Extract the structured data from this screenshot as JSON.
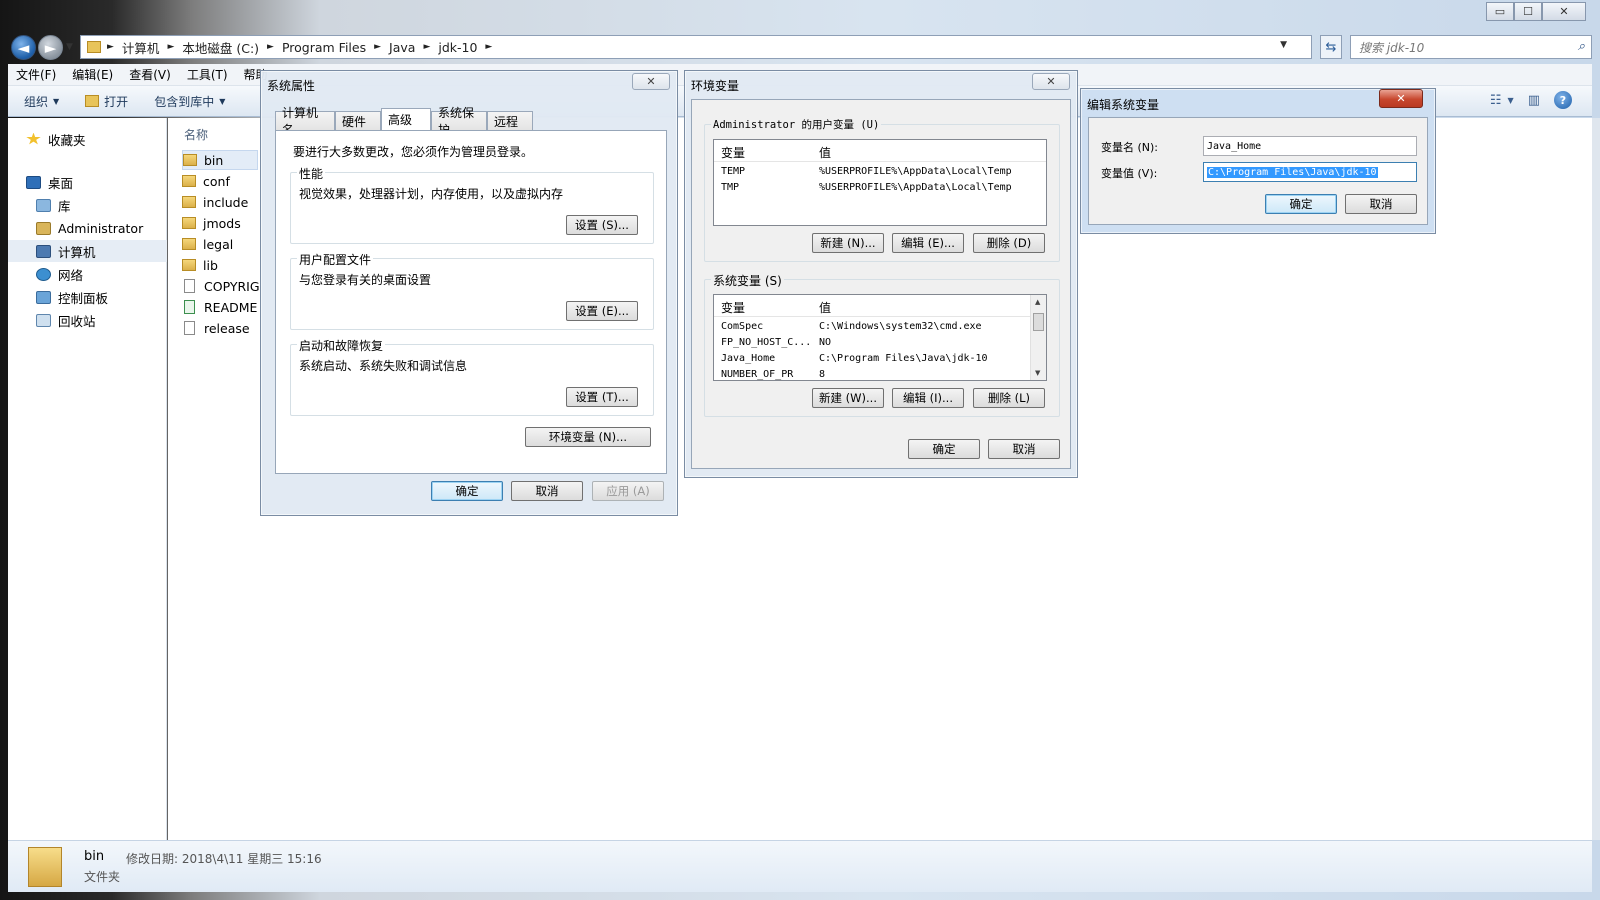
{
  "explorer": {
    "window_buttons": {
      "min": "▭",
      "max": "☐",
      "close": "✕"
    },
    "breadcrumbs": [
      "计算机",
      "本地磁盘 (C:)",
      "Program Files",
      "Java",
      "jdk-10"
    ],
    "search_placeholder": "搜索 jdk-10",
    "menu": [
      "文件(F)",
      "编辑(E)",
      "查看(V)",
      "工具(T)",
      "帮助"
    ],
    "toolbar": {
      "organize": "组织",
      "open": "打开",
      "include": "包含到库中"
    },
    "nav": {
      "favorites": "收藏夹",
      "desktop": "桌面",
      "library": "库",
      "administrator": "Administrator",
      "computer": "计算机",
      "network": "网络",
      "control_panel": "控制面板",
      "recycle_bin": "回收站"
    },
    "column_name": "名称",
    "files": [
      {
        "name": "bin",
        "type": "folder"
      },
      {
        "name": "conf",
        "type": "folder"
      },
      {
        "name": "include",
        "type": "folder"
      },
      {
        "name": "jmods",
        "type": "folder"
      },
      {
        "name": "legal",
        "type": "folder"
      },
      {
        "name": "lib",
        "type": "folder"
      },
      {
        "name": "COPYRIG",
        "type": "file"
      },
      {
        "name": "README",
        "type": "file"
      },
      {
        "name": "release",
        "type": "file"
      }
    ],
    "details": {
      "name": "bin",
      "modified": "修改日期: 2018\\4\\11 星期三 15:16",
      "type": "文件夹"
    }
  },
  "sysprops": {
    "title": "系统属性",
    "tabs": [
      "计算机名",
      "硬件",
      "高级",
      "系统保护",
      "远程"
    ],
    "admin_note": "要进行大多数更改，您必须作为管理员登录。",
    "perf_title": "性能",
    "perf_desc": "视觉效果，处理器计划，内存使用，以及虚拟内存",
    "perf_btn": "设置 (S)...",
    "profile_title": "用户配置文件",
    "profile_desc": "与您登录有关的桌面设置",
    "profile_btn": "设置 (E)...",
    "startup_title": "启动和故障恢复",
    "startup_desc": "系统启动、系统失败和调试信息",
    "startup_btn": "设置 (T)...",
    "env_btn": "环境变量 (N)...",
    "ok": "确定",
    "cancel": "取消",
    "apply": "应用 (A)"
  },
  "envvars": {
    "title": "环境变量",
    "user_group": "Administrator 的用户变量 (U)",
    "col_var": "变量",
    "col_val": "值",
    "user_vars": [
      {
        "name": "TEMP",
        "value": "%USERPROFILE%\\AppData\\Local\\Temp"
      },
      {
        "name": "TMP",
        "value": "%USERPROFILE%\\AppData\\Local\\Temp"
      }
    ],
    "user_new": "新建 (N)...",
    "user_edit": "编辑 (E)...",
    "user_delete": "删除 (D)",
    "sys_group": "系统变量 (S)",
    "sys_vars": [
      {
        "name": "ComSpec",
        "value": "C:\\Windows\\system32\\cmd.exe"
      },
      {
        "name": "FP_NO_HOST_C...",
        "value": "NO"
      },
      {
        "name": "Java_Home",
        "value": "C:\\Program Files\\Java\\jdk-10"
      },
      {
        "name": "NUMBER_OF_PR",
        "value": "8"
      }
    ],
    "sys_new": "新建 (W)...",
    "sys_edit": "编辑 (I)...",
    "sys_delete": "删除 (L)",
    "ok": "确定",
    "cancel": "取消"
  },
  "editvar": {
    "title": "编辑系统变量",
    "name_label": "变量名 (N):",
    "name_value": "Java_Home",
    "value_label": "变量值 (V):",
    "value_value": "C:\\Program Files\\Java\\jdk-10",
    "ok": "确定",
    "cancel": "取消"
  }
}
